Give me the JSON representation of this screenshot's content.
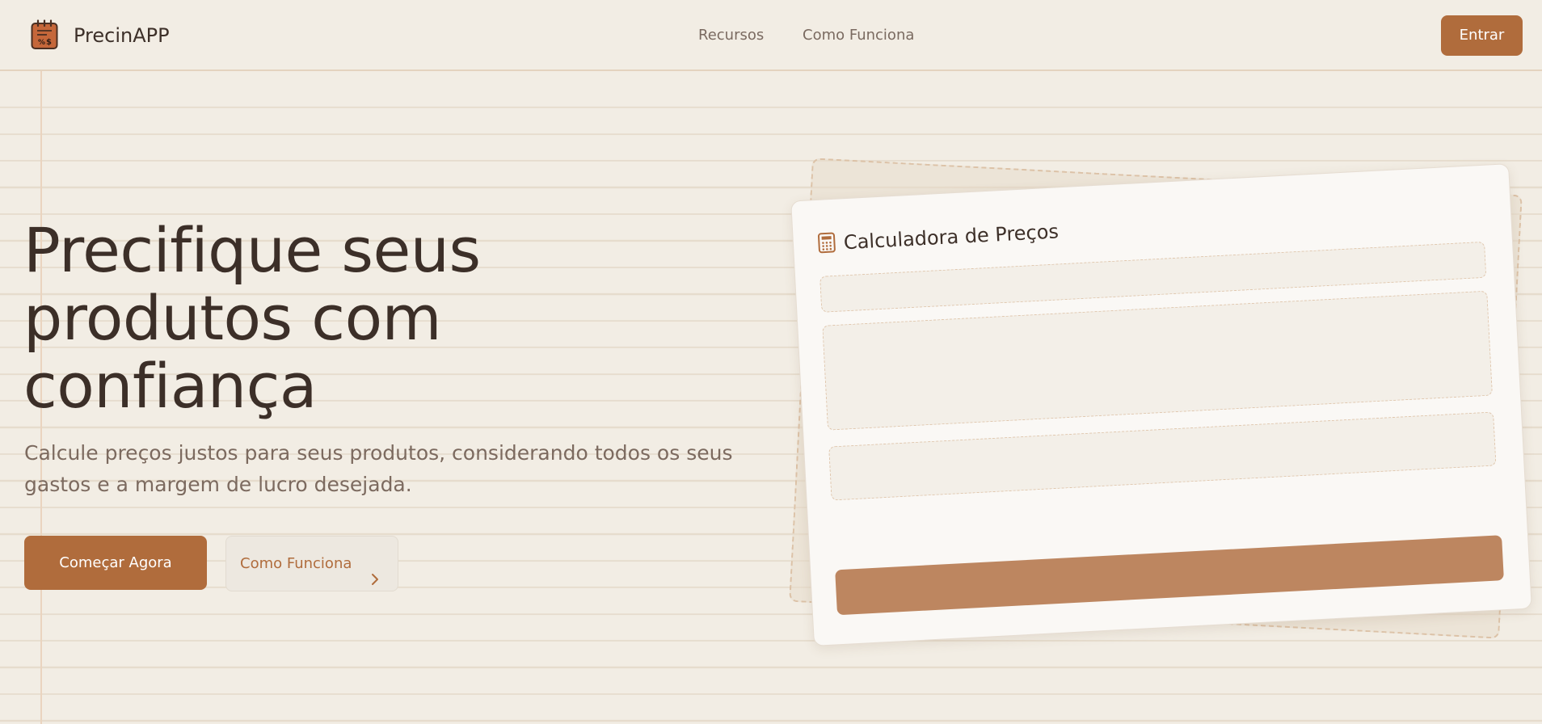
{
  "header": {
    "brand": "PrecinAPP",
    "logo_icon": "calculator-notepad-icon",
    "nav": [
      {
        "label": "Recursos"
      },
      {
        "label": "Como Funciona"
      }
    ],
    "login_label": "Entrar"
  },
  "hero": {
    "title_lines": [
      "Precifique seus",
      "produtos com",
      "confiança"
    ],
    "subtitle_lines": [
      "Calcule preços justos para seus produtos, considerando todos os seus",
      "gastos e a margem de lucro desejada."
    ],
    "primary_cta": "Começar Agora",
    "secondary_cta": "Como Funciona",
    "secondary_icon": "chevron-right-icon"
  },
  "card": {
    "title": "Calculadora de Preços",
    "icon": "calculator-icon"
  },
  "colors": {
    "accent": "#b06c3c",
    "background": "#f2ede4",
    "text": "#3c2f28",
    "muted": "#7c6a5f"
  }
}
